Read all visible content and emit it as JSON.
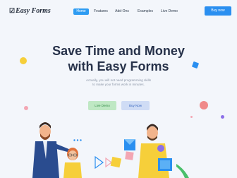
{
  "brand": {
    "name": "Easy Forms",
    "icon": "pencil-checkbox-icon"
  },
  "nav": {
    "items": [
      {
        "label": "Home",
        "active": true
      },
      {
        "label": "Features",
        "active": false
      },
      {
        "label": "Add-Ons",
        "active": false
      },
      {
        "label": "Examples",
        "active": false
      },
      {
        "label": "Live Demo",
        "active": false
      }
    ],
    "buy_label": "Buy now"
  },
  "hero": {
    "title_line1": "Save Time and Money",
    "title_line2": "with Easy Forms",
    "subtitle_line1": "Actually, you will not need programming skills",
    "subtitle_line2": "to make your forms work in minutes.",
    "demo_button": "Live Demo",
    "buy_button": "Buy Now"
  },
  "colors": {
    "background": "#f3f6fb",
    "primary": "#2a8ff0",
    "title": "#27324a",
    "demo_button_bg": "#bfe8c4",
    "buy_button_bg": "#cfdcf5"
  }
}
